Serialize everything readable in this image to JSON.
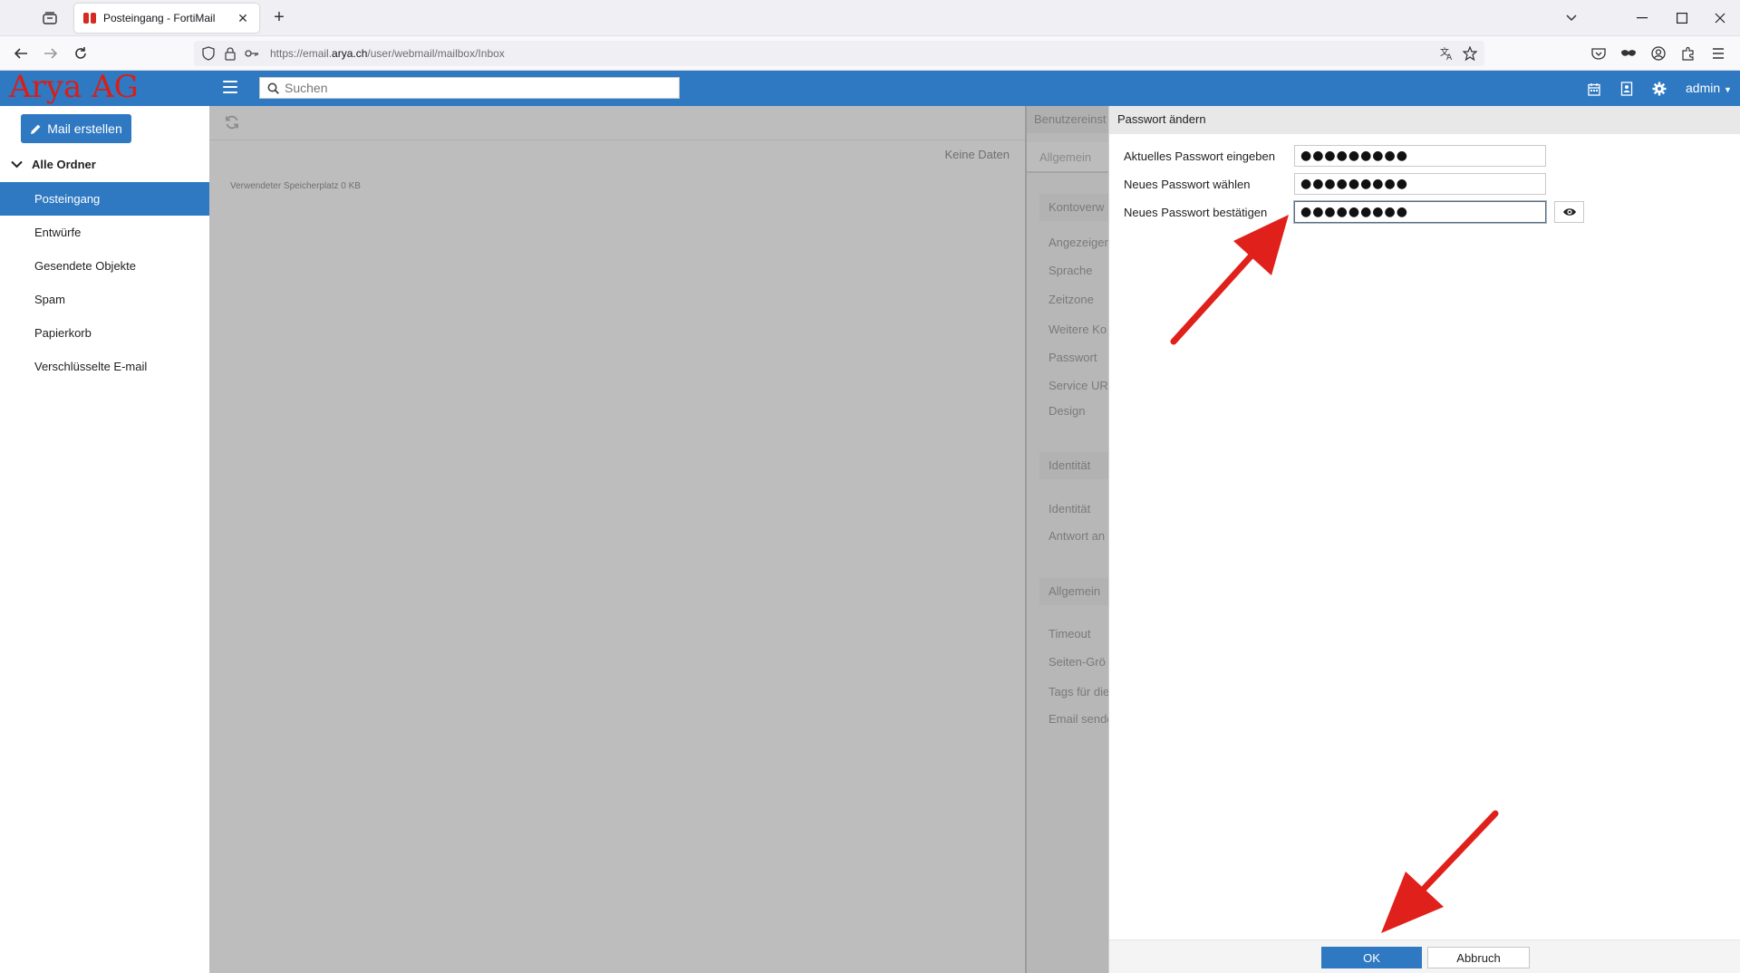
{
  "browser": {
    "tab_title": "Posteingang - FortiMail",
    "new_tab": "+",
    "url_prefix": "https://email.",
    "url_host": "arya.ch",
    "url_path": "/user/webmail/mailbox/Inbox"
  },
  "header": {
    "logo": "Arya AG",
    "search_placeholder": "Suchen",
    "user": "admin"
  },
  "sidebar": {
    "compose": "Mail erstellen",
    "root": "Alle Ordner",
    "folders": [
      {
        "label": "Posteingang",
        "active": true
      },
      {
        "label": "Entwürfe",
        "active": false
      },
      {
        "label": "Gesendete Objekte",
        "active": false
      },
      {
        "label": "Spam",
        "active": false
      },
      {
        "label": "Papierkorb",
        "active": false
      },
      {
        "label": "Verschlüsselte E-mail",
        "active": false
      }
    ]
  },
  "main": {
    "no_data": "Keine Daten",
    "storage": "Verwendeter Speicherplatz 0 KB"
  },
  "settings": {
    "header": "Benutzereinst",
    "tab": "Allgemein",
    "groups": [
      "Kontoverw",
      "Identität",
      "Allgemein"
    ],
    "items": [
      "Angezeigen",
      "Sprache",
      "Zeitzone",
      "Weitere Ko",
      "Passwort",
      "Service UR",
      "Design",
      "Identität",
      "Antwort an",
      "Timeout",
      "Seiten-Grö",
      "Tags für die",
      "Email sende"
    ]
  },
  "dialog": {
    "title": "Passwort ändern",
    "fields": [
      {
        "label": "Aktuelles Passwort eingeben",
        "value": "●●●●●●●●●"
      },
      {
        "label": "Neues Passwort wählen",
        "value": "●●●●●●●●●"
      },
      {
        "label": "Neues Passwort bestätigen",
        "value": "●●●●●●●●●"
      }
    ],
    "ok": "OK",
    "cancel": "Abbruch"
  },
  "colors": {
    "brand_blue": "#2f79c2",
    "logo_red": "#d91e18",
    "annotation_red": "#e0201b"
  }
}
